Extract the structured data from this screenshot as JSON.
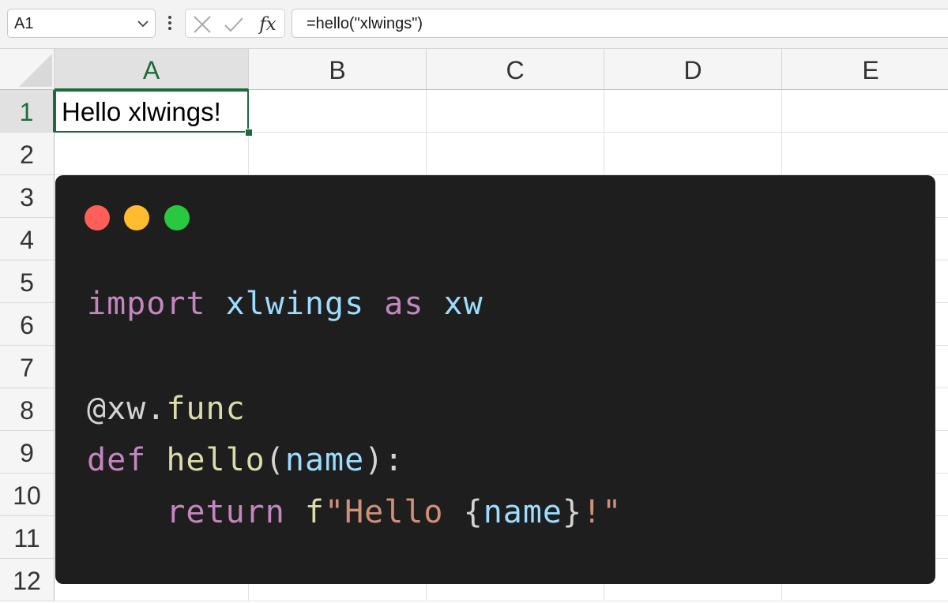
{
  "formula_bar": {
    "name_box": "A1",
    "formula": "=hello(\"xlwings\")",
    "fx_label": "fx"
  },
  "columns": [
    "A",
    "B",
    "C",
    "D",
    "E"
  ],
  "rows": [
    "1",
    "2",
    "3",
    "4",
    "5",
    "6",
    "7",
    "8",
    "9",
    "10",
    "11",
    "12"
  ],
  "active_column": "A",
  "active_row": "1",
  "cells": {
    "A1": "Hello xlwings!"
  },
  "code_image": {
    "window_dots": [
      "red",
      "yellow",
      "green"
    ],
    "dot_colors": {
      "red": "#ff5f57",
      "yellow": "#febc2e",
      "green": "#28c840"
    },
    "lines": [
      [
        {
          "t": "import",
          "c": "kw"
        },
        {
          "t": " ",
          "c": "punc"
        },
        {
          "t": "xlwings",
          "c": "mod"
        },
        {
          "t": " ",
          "c": "punc"
        },
        {
          "t": "as",
          "c": "kw"
        },
        {
          "t": " ",
          "c": "punc"
        },
        {
          "t": "xw",
          "c": "mod"
        }
      ],
      [
        {
          "t": "@xw.",
          "c": "deco"
        },
        {
          "t": "func",
          "c": "fn"
        }
      ],
      [
        {
          "t": "def",
          "c": "kw"
        },
        {
          "t": " ",
          "c": "punc"
        },
        {
          "t": "hello",
          "c": "fn"
        },
        {
          "t": "(",
          "c": "punc"
        },
        {
          "t": "name",
          "c": "var"
        },
        {
          "t": "):",
          "c": "punc"
        }
      ],
      [
        {
          "t": "    ",
          "c": "punc"
        },
        {
          "t": "return",
          "c": "kw"
        },
        {
          "t": " ",
          "c": "punc"
        },
        {
          "t": "f",
          "c": "fn"
        },
        {
          "t": "\"Hello ",
          "c": "str"
        },
        {
          "t": "{",
          "c": "punc"
        },
        {
          "t": "name",
          "c": "var"
        },
        {
          "t": "}",
          "c": "punc"
        },
        {
          "t": "!\"",
          "c": "str"
        }
      ]
    ]
  },
  "colors": {
    "accent_green": "#1d6b3a",
    "code_background": "#1e1e1e"
  }
}
